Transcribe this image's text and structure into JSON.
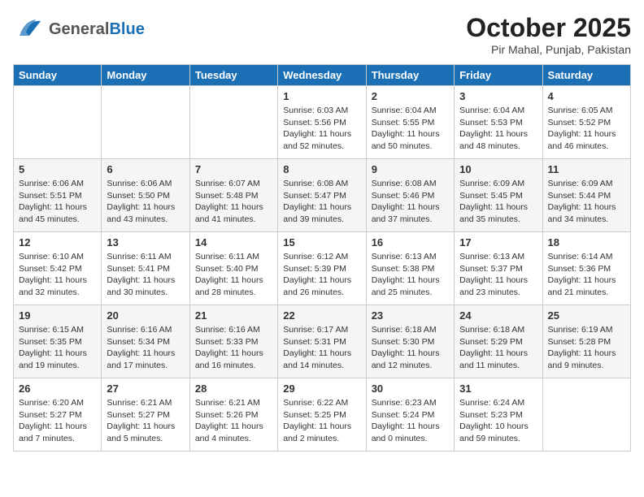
{
  "header": {
    "logo_general": "General",
    "logo_blue": "Blue",
    "month": "October 2025",
    "location": "Pir Mahal, Punjab, Pakistan"
  },
  "weekdays": [
    "Sunday",
    "Monday",
    "Tuesday",
    "Wednesday",
    "Thursday",
    "Friday",
    "Saturday"
  ],
  "weeks": [
    [
      {
        "day": "",
        "info": ""
      },
      {
        "day": "",
        "info": ""
      },
      {
        "day": "",
        "info": ""
      },
      {
        "day": "1",
        "info": "Sunrise: 6:03 AM\nSunset: 5:56 PM\nDaylight: 11 hours\nand 52 minutes."
      },
      {
        "day": "2",
        "info": "Sunrise: 6:04 AM\nSunset: 5:55 PM\nDaylight: 11 hours\nand 50 minutes."
      },
      {
        "day": "3",
        "info": "Sunrise: 6:04 AM\nSunset: 5:53 PM\nDaylight: 11 hours\nand 48 minutes."
      },
      {
        "day": "4",
        "info": "Sunrise: 6:05 AM\nSunset: 5:52 PM\nDaylight: 11 hours\nand 46 minutes."
      }
    ],
    [
      {
        "day": "5",
        "info": "Sunrise: 6:06 AM\nSunset: 5:51 PM\nDaylight: 11 hours\nand 45 minutes."
      },
      {
        "day": "6",
        "info": "Sunrise: 6:06 AM\nSunset: 5:50 PM\nDaylight: 11 hours\nand 43 minutes."
      },
      {
        "day": "7",
        "info": "Sunrise: 6:07 AM\nSunset: 5:48 PM\nDaylight: 11 hours\nand 41 minutes."
      },
      {
        "day": "8",
        "info": "Sunrise: 6:08 AM\nSunset: 5:47 PM\nDaylight: 11 hours\nand 39 minutes."
      },
      {
        "day": "9",
        "info": "Sunrise: 6:08 AM\nSunset: 5:46 PM\nDaylight: 11 hours\nand 37 minutes."
      },
      {
        "day": "10",
        "info": "Sunrise: 6:09 AM\nSunset: 5:45 PM\nDaylight: 11 hours\nand 35 minutes."
      },
      {
        "day": "11",
        "info": "Sunrise: 6:09 AM\nSunset: 5:44 PM\nDaylight: 11 hours\nand 34 minutes."
      }
    ],
    [
      {
        "day": "12",
        "info": "Sunrise: 6:10 AM\nSunset: 5:42 PM\nDaylight: 11 hours\nand 32 minutes."
      },
      {
        "day": "13",
        "info": "Sunrise: 6:11 AM\nSunset: 5:41 PM\nDaylight: 11 hours\nand 30 minutes."
      },
      {
        "day": "14",
        "info": "Sunrise: 6:11 AM\nSunset: 5:40 PM\nDaylight: 11 hours\nand 28 minutes."
      },
      {
        "day": "15",
        "info": "Sunrise: 6:12 AM\nSunset: 5:39 PM\nDaylight: 11 hours\nand 26 minutes."
      },
      {
        "day": "16",
        "info": "Sunrise: 6:13 AM\nSunset: 5:38 PM\nDaylight: 11 hours\nand 25 minutes."
      },
      {
        "day": "17",
        "info": "Sunrise: 6:13 AM\nSunset: 5:37 PM\nDaylight: 11 hours\nand 23 minutes."
      },
      {
        "day": "18",
        "info": "Sunrise: 6:14 AM\nSunset: 5:36 PM\nDaylight: 11 hours\nand 21 minutes."
      }
    ],
    [
      {
        "day": "19",
        "info": "Sunrise: 6:15 AM\nSunset: 5:35 PM\nDaylight: 11 hours\nand 19 minutes."
      },
      {
        "day": "20",
        "info": "Sunrise: 6:16 AM\nSunset: 5:34 PM\nDaylight: 11 hours\nand 17 minutes."
      },
      {
        "day": "21",
        "info": "Sunrise: 6:16 AM\nSunset: 5:33 PM\nDaylight: 11 hours\nand 16 minutes."
      },
      {
        "day": "22",
        "info": "Sunrise: 6:17 AM\nSunset: 5:31 PM\nDaylight: 11 hours\nand 14 minutes."
      },
      {
        "day": "23",
        "info": "Sunrise: 6:18 AM\nSunset: 5:30 PM\nDaylight: 11 hours\nand 12 minutes."
      },
      {
        "day": "24",
        "info": "Sunrise: 6:18 AM\nSunset: 5:29 PM\nDaylight: 11 hours\nand 11 minutes."
      },
      {
        "day": "25",
        "info": "Sunrise: 6:19 AM\nSunset: 5:28 PM\nDaylight: 11 hours\nand 9 minutes."
      }
    ],
    [
      {
        "day": "26",
        "info": "Sunrise: 6:20 AM\nSunset: 5:27 PM\nDaylight: 11 hours\nand 7 minutes."
      },
      {
        "day": "27",
        "info": "Sunrise: 6:21 AM\nSunset: 5:27 PM\nDaylight: 11 hours\nand 5 minutes."
      },
      {
        "day": "28",
        "info": "Sunrise: 6:21 AM\nSunset: 5:26 PM\nDaylight: 11 hours\nand 4 minutes."
      },
      {
        "day": "29",
        "info": "Sunrise: 6:22 AM\nSunset: 5:25 PM\nDaylight: 11 hours\nand 2 minutes."
      },
      {
        "day": "30",
        "info": "Sunrise: 6:23 AM\nSunset: 5:24 PM\nDaylight: 11 hours\nand 0 minutes."
      },
      {
        "day": "31",
        "info": "Sunrise: 6:24 AM\nSunset: 5:23 PM\nDaylight: 10 hours\nand 59 minutes."
      },
      {
        "day": "",
        "info": ""
      }
    ]
  ]
}
